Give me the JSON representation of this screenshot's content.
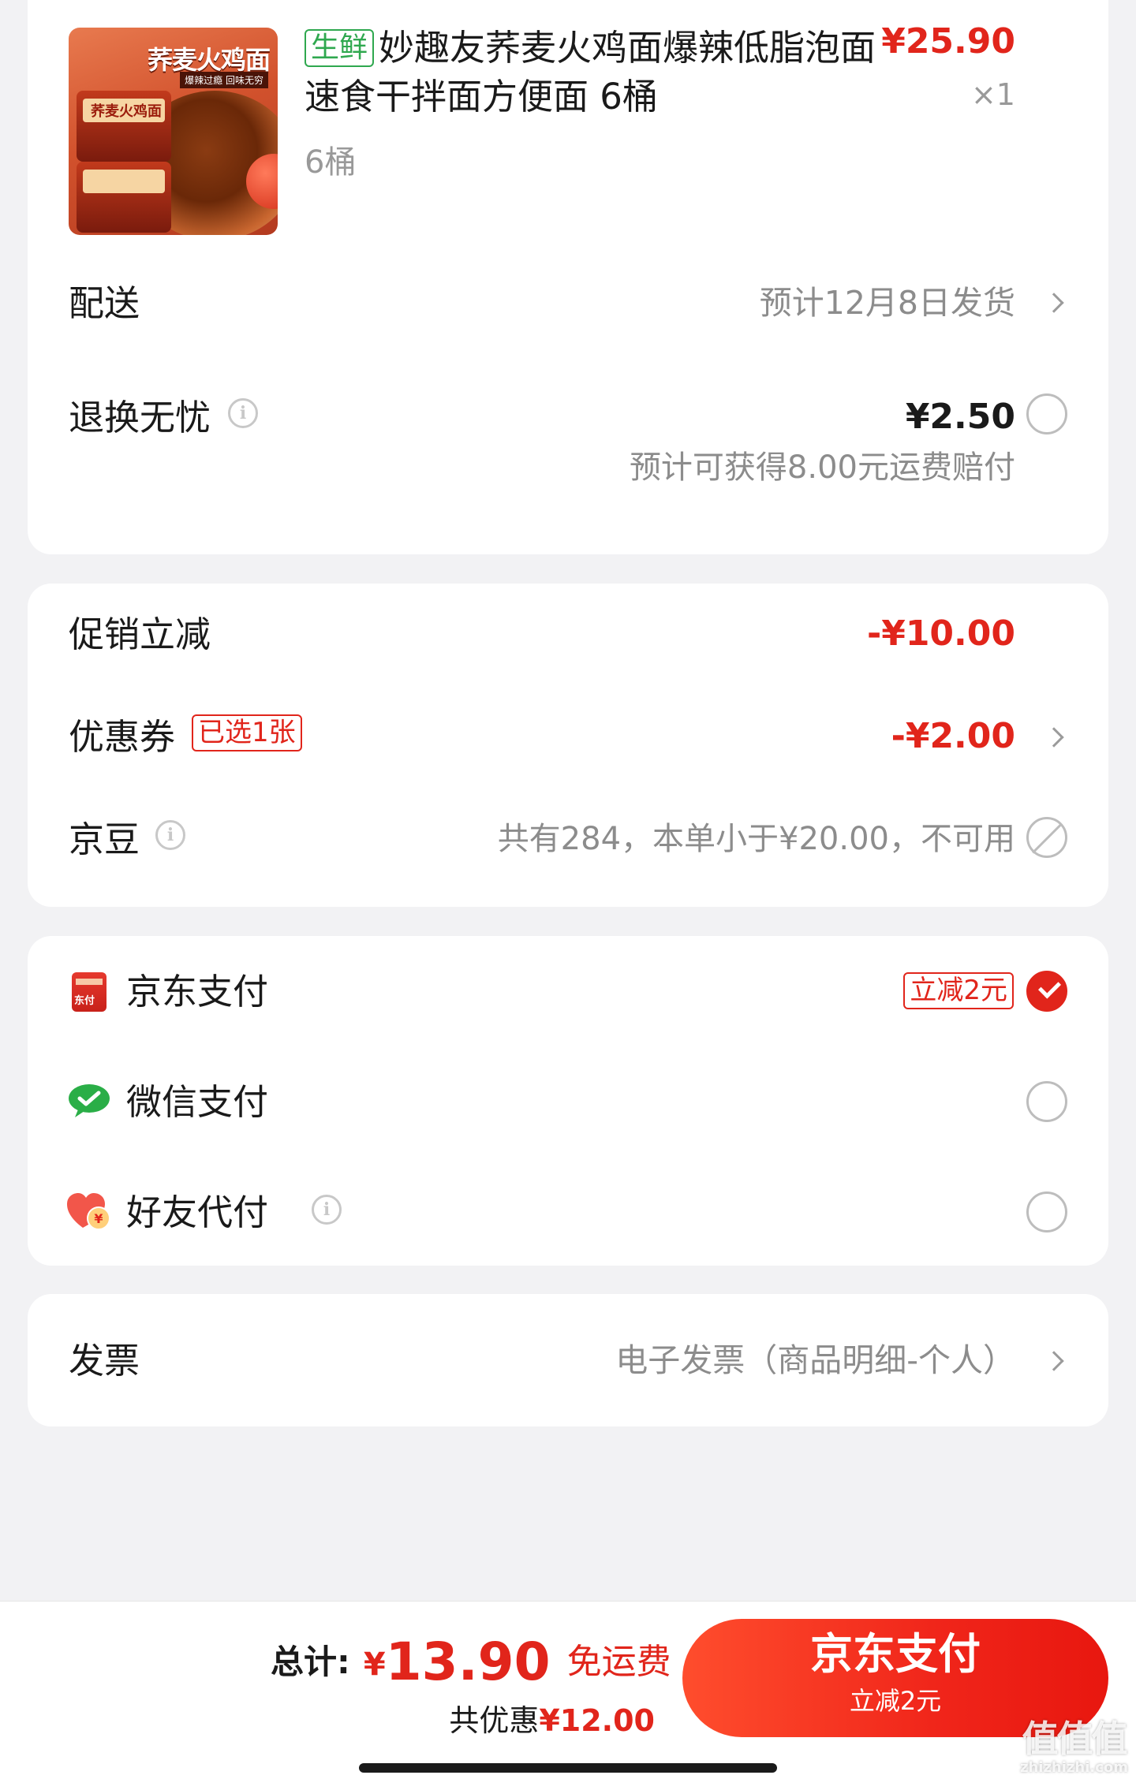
{
  "product": {
    "tag": "生鲜",
    "title": "妙趣友荞麦火鸡面爆辣低脂泡面速食干拌面方便面 6桶",
    "spec": "6桶",
    "price": "¥25.90",
    "quantity": "×1",
    "image_text": {
      "brand": "荞麦火鸡面",
      "slogan": "爆辣过瘾 回味无穷",
      "cup_label": "荞麦火鸡面"
    }
  },
  "delivery": {
    "label": "配送",
    "value": "预计12月8日发货"
  },
  "return_insurance": {
    "label": "退换无忧",
    "price": "¥2.50",
    "note": "预计可获得8.00元运费赔付"
  },
  "discounts": {
    "promo_label": "促销立减",
    "promo_value": "-¥10.00",
    "coupon_label": "优惠券",
    "coupon_badge": "已选1张",
    "coupon_value": "-¥2.00",
    "jingdou_label": "京豆",
    "jingdou_value": "共有284，本单小于¥20.00，不可用"
  },
  "payment": {
    "methods": [
      {
        "label": "京东支付",
        "badge": "立减2元",
        "icon": "jd-pay-icon",
        "icon_text": "东付",
        "selected": true
      },
      {
        "label": "微信支付",
        "icon": "wechat-icon",
        "selected": false
      },
      {
        "label": "好友代付",
        "icon": "friend-pay-icon",
        "icon_text": "¥",
        "selected": false
      }
    ]
  },
  "invoice": {
    "label": "发票",
    "value": "电子发票（商品明细-个人）"
  },
  "footer": {
    "total_label": "总计:",
    "currency": "¥",
    "total_value": "13.90",
    "free_shipping": "免运费",
    "saved_label": "共优惠",
    "saved_value": "¥12.00",
    "button_label": "京东支付",
    "button_sub": "立减2元"
  },
  "watermark": {
    "title": "值值值",
    "url": "zhizhizhi.com"
  },
  "colors": {
    "accent": "#e1251b",
    "fresh_tag": "#2fa84f",
    "background": "#f2f2f4"
  }
}
